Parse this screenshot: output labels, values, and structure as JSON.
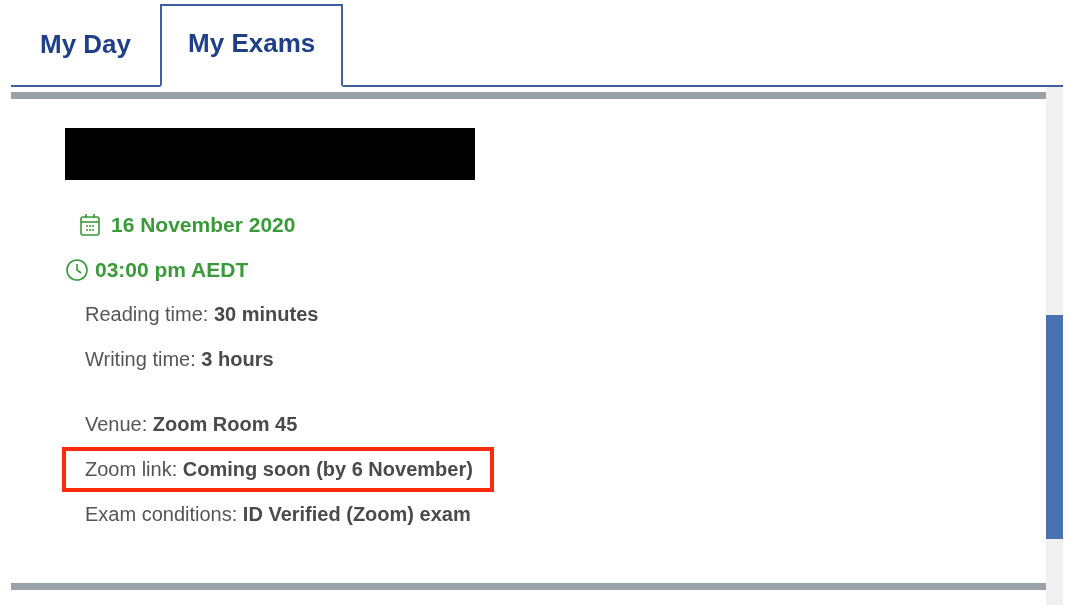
{
  "tabs": [
    {
      "label": "My Day",
      "selected": false
    },
    {
      "label": "My Exams",
      "selected": true
    }
  ],
  "exam": {
    "date": "16 November 2020",
    "time": "03:00 pm AEDT",
    "durations": [
      {
        "label": "Reading time:",
        "value": "30 minutes",
        "highlighted": false
      },
      {
        "label": "Writing time:",
        "value": "3 hours",
        "highlighted": false
      }
    ],
    "details": [
      {
        "label": "Venue:",
        "value": "Zoom Room 45",
        "highlighted": false
      },
      {
        "label": "Zoom link:",
        "value": "Coming soon (by 6 November)",
        "highlighted": true
      },
      {
        "label": "Exam conditions:",
        "value": "ID Verified (Zoom) exam",
        "highlighted": false
      }
    ]
  }
}
